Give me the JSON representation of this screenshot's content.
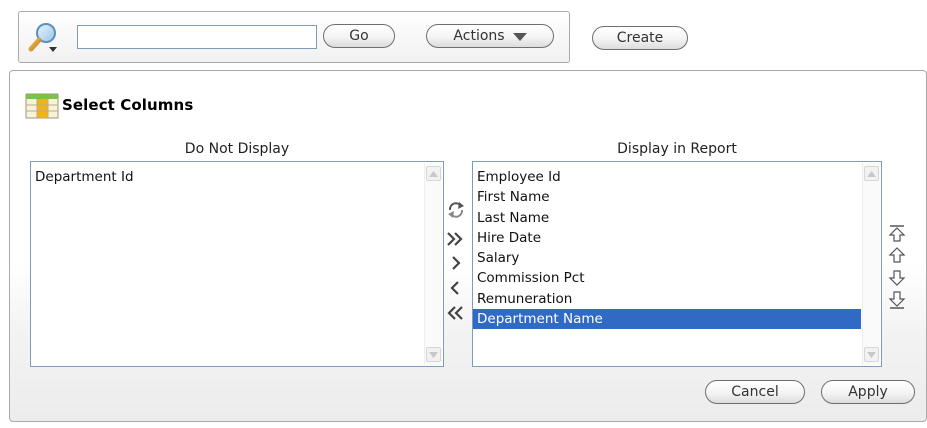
{
  "search": {
    "value": "",
    "placeholder": "",
    "go_label": "Go",
    "actions_label": "Actions",
    "create_label": "Create"
  },
  "panel": {
    "title": "Select Columns",
    "do_not_display": {
      "header": "Do Not Display",
      "items": [
        "Department Id"
      ]
    },
    "display_in_report": {
      "header": "Display in Report",
      "items": [
        "Employee Id",
        "First Name",
        "Last Name",
        "Hire Date",
        "Salary",
        "Commission Pct",
        "Remuneration",
        "Department Name"
      ],
      "selected": "Department Name"
    },
    "move_controls": [
      "reset-icon",
      "move-all-right-icon",
      "move-right-icon",
      "move-left-icon",
      "move-all-left-icon"
    ],
    "order_controls": [
      "move-top-icon",
      "move-up-icon",
      "move-down-icon",
      "move-bottom-icon"
    ],
    "cancel_label": "Cancel",
    "apply_label": "Apply"
  },
  "colors": {
    "selection": "#316ac5",
    "listbox_border": "#7f9db9",
    "panel_border": "#a9a9a9"
  }
}
